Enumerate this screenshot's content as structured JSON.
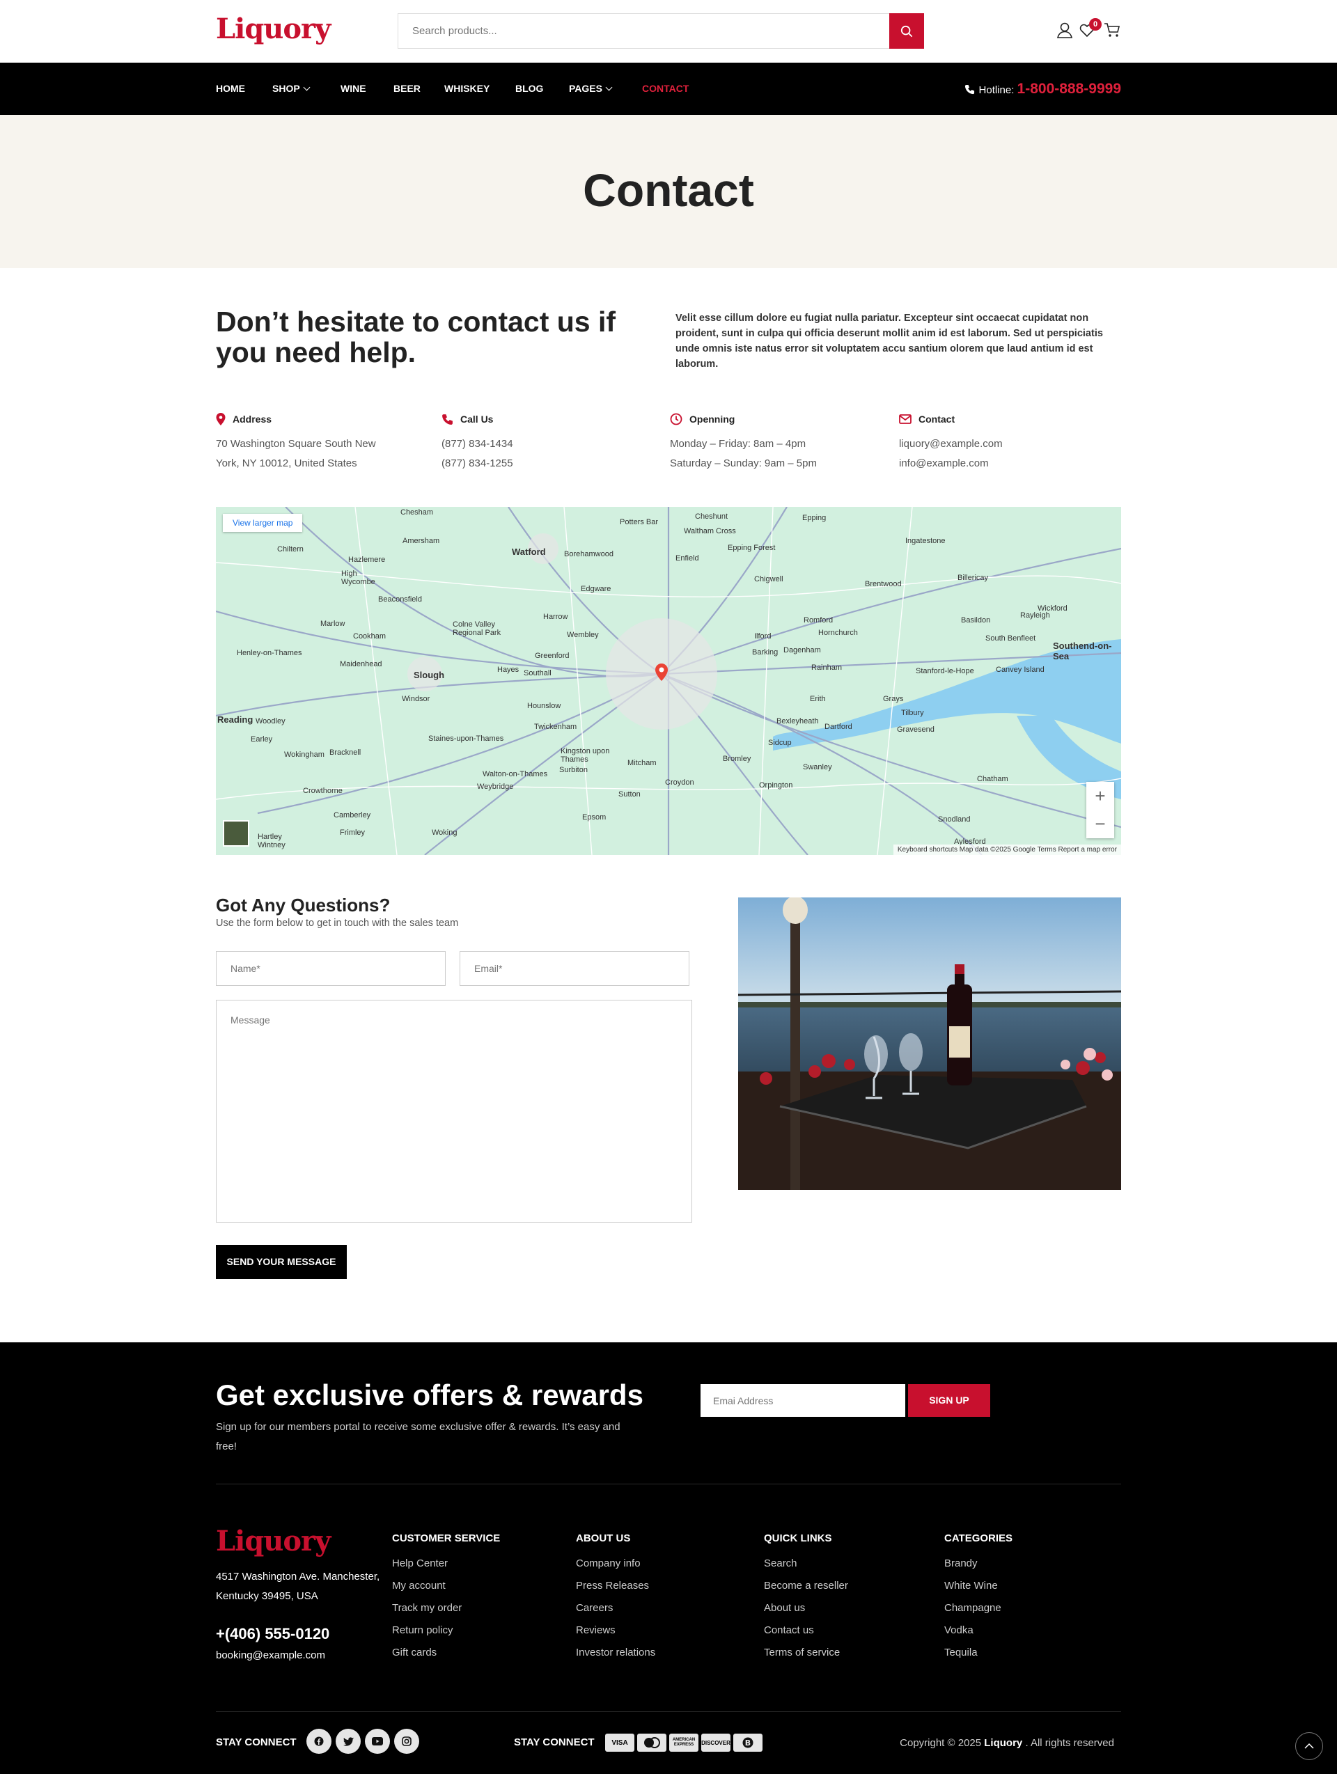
{
  "brand": {
    "name": "Liquory",
    "color": "#c8102e"
  },
  "search": {
    "placeholder": "Search products..."
  },
  "header": {
    "wishlist_count": "0"
  },
  "nav": {
    "items": [
      {
        "label": "HOME"
      },
      {
        "label": "SHOP"
      },
      {
        "label": "WINE"
      },
      {
        "label": "BEER"
      },
      {
        "label": "WHISKEY"
      },
      {
        "label": "BLOG"
      },
      {
        "label": "PAGES"
      },
      {
        "label": "CONTACT"
      }
    ],
    "hotline_label": "Hotline:",
    "hotline_number": "1-800-888-9999"
  },
  "page": {
    "title": "Contact"
  },
  "intro": {
    "heading": "Don’t hesitate to contact us if you need help.",
    "text": "Velit esse cillum dolore eu fugiat nulla pariatur. Excepteur sint occaecat cupidatat non proident, sunt in culpa qui officia deserunt mollit anim id est laborum. Sed ut perspiciatis unde omnis iste natus error sit voluptatem accu santium olorem que laud antium id est laborum."
  },
  "info": [
    {
      "title": "Address",
      "icon": "map-pin-icon",
      "lines": [
        "70 Washington Square South New",
        "York, NY 10012, United States"
      ]
    },
    {
      "title": "Call Us",
      "icon": "phone-icon",
      "lines": [
        "(877) 834-1434",
        "(877) 834-1255"
      ]
    },
    {
      "title": "Openning",
      "icon": "clock-icon",
      "lines": [
        "Monday – Friday: 8am – 4pm",
        "Saturday – Sunday: 9am – 5pm"
      ]
    },
    {
      "title": "Contact",
      "icon": "envelope-icon",
      "lines": [
        "liquory@example.com",
        "info@example.com"
      ]
    }
  ],
  "map": {
    "link": "View larger map",
    "footer": "Keyboard shortcuts   Map data ©2025 Google   Terms   Report a map error",
    "places": [
      "Chesham",
      "Potters Bar",
      "Cheshunt",
      "Epping",
      "Amersham",
      "Watford",
      "Borehamwood",
      "Waltham Cross",
      "Epping Forest",
      "Ingatestone",
      "Chiltern",
      "Enfield",
      "High Wycombe",
      "Hazlemere",
      "Chigwell",
      "Brentwood",
      "Billericay",
      "Beaconsfield",
      "Edgware",
      "Romford",
      "Wickford",
      "Harrow",
      "Hornchurch",
      "Basildon",
      "Rayleigh",
      "Marlow",
      "Cookham",
      "Colne Valley Regional Park",
      "Wembley",
      "Ilford",
      "Dagenham",
      "Barking",
      "South Benfleet",
      "Southend-on-Sea",
      "Henley-on-Thames",
      "Maidenhead",
      "Greenford",
      "Stanford-le-Hope",
      "Canvey Island",
      "Hayes",
      "Southall",
      "Slough",
      "Rainham",
      "Windsor",
      "Hounslow",
      "Erith",
      "Grays",
      "Reading",
      "Woodley",
      "Twickenham",
      "Bexleyheath",
      "Dartford",
      "Tilbury",
      "Earley",
      "Staines-upon-Thames",
      "Gravesend",
      "Wokingham",
      "Bracknell",
      "Kingston upon Thames",
      "Sidcup",
      "Mitcham",
      "Bromley",
      "Surbiton",
      "Walton-on-Thames",
      "Swanley",
      "Crowthorne",
      "Weybridge",
      "Croydon",
      "Orpington",
      "Chatham",
      "Epsom",
      "Sutton",
      "Camberley",
      "Snodland",
      "Frimley",
      "Woking",
      "Hartley Wintney",
      "Aylesford"
    ]
  },
  "form": {
    "heading": "Got Any Questions?",
    "subtext": "Use the form below to get in touch with the sales team",
    "name_placeholder": "Name*",
    "email_placeholder": "Email*",
    "message_placeholder": "Message",
    "submit_label": "SEND YOUR MESSAGE"
  },
  "newsletter": {
    "heading": "Get exclusive offers & rewards",
    "text": "Sign up for our members portal to receive some exclusive offer & rewards. It’s easy and free!",
    "email_placeholder": "Emai Address",
    "button": "SIGN UP"
  },
  "footer": {
    "address": "4517 Washington Ave. Manchester, Kentucky 39495, USA",
    "phone": "+(406) 555-0120",
    "email": "booking@example.com",
    "columns": [
      {
        "title": "CUSTOMER SERVICE",
        "items": [
          "Help Center",
          "My account",
          "Track my order",
          "Return policy",
          "Gift cards"
        ]
      },
      {
        "title": "ABOUT US",
        "items": [
          "Company info",
          "Press Releases",
          "Careers",
          "Reviews",
          "Investor relations"
        ]
      },
      {
        "title": "QUICK LINKS",
        "items": [
          "Search",
          "Become a reseller",
          "About us",
          "Contact us",
          "Terms of service"
        ]
      },
      {
        "title": "CATEGORIES",
        "items": [
          "Brandy",
          "White Wine",
          "Champagne",
          "Vodka",
          "Tequila"
        ]
      }
    ],
    "stay_connect_1": "STAY CONNECT",
    "stay_connect_2": "STAY CONNECT",
    "social_icons": [
      "facebook-icon",
      "twitter-icon",
      "youtube-icon",
      "instagram-icon"
    ],
    "payments": [
      "VISA",
      "Mastercard",
      "AMERICAN EXPRESS",
      "DISCOVER",
      "Bitcoin"
    ],
    "copyright_prefix": "Copyright © 2025",
    "copyright_brand": "Liquory",
    "copyright_suffix": ". All rights reserved"
  }
}
